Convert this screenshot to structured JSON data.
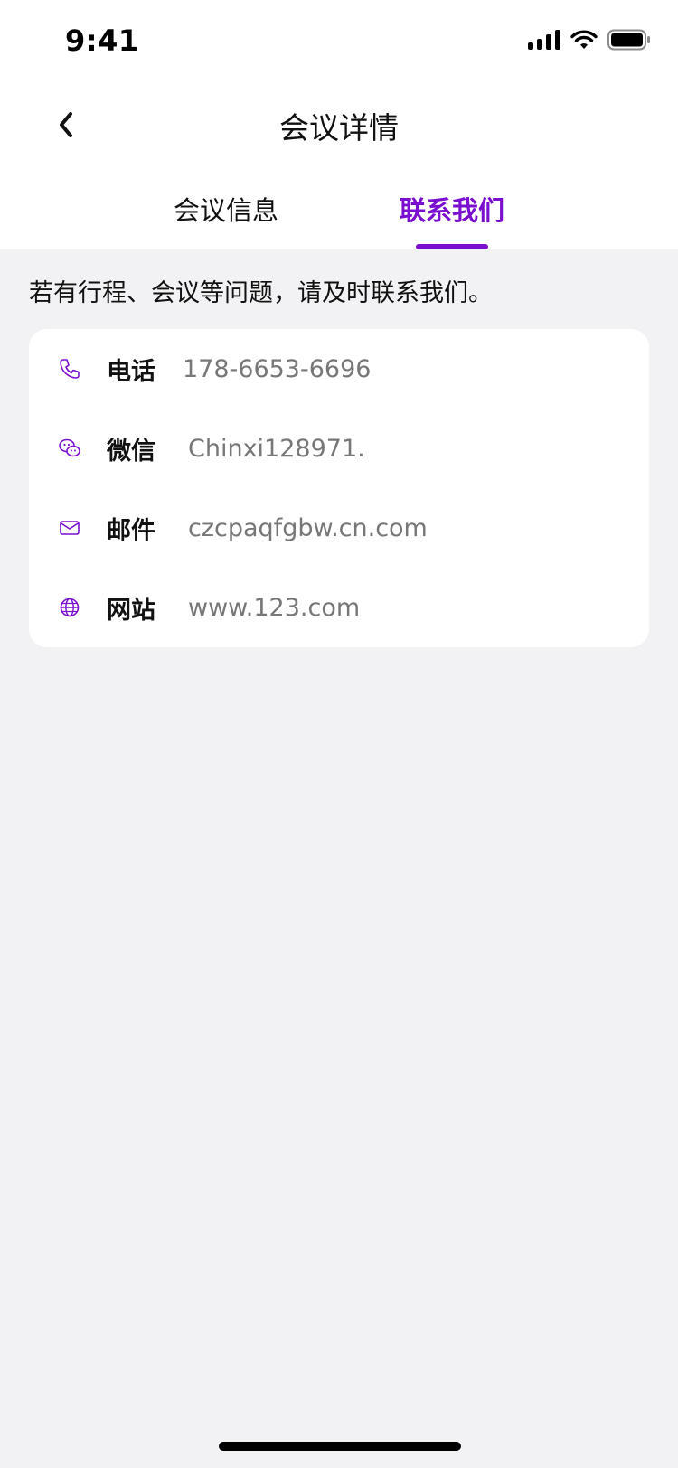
{
  "status_bar": {
    "time": "9:41"
  },
  "nav": {
    "title": "会议详情"
  },
  "tabs": [
    {
      "label": "会议信息",
      "active": false
    },
    {
      "label": "联系我们",
      "active": true
    }
  ],
  "note": "若有行程、会议等问题，请及时联系我们。",
  "contacts": [
    {
      "icon": "phone-icon",
      "label": "电话",
      "value": "178-6653-6696"
    },
    {
      "icon": "wechat-icon",
      "label": "微信",
      "value": "Chinxi128971."
    },
    {
      "icon": "mail-icon",
      "label": "邮件",
      "value": "czcpaqfgbw.cn.com"
    },
    {
      "icon": "globe-icon",
      "label": "网站",
      "value": "www.123.com"
    }
  ],
  "colors": {
    "accent": "#7B0FD0",
    "background": "#F2F2F4",
    "value_text": "#777777"
  }
}
